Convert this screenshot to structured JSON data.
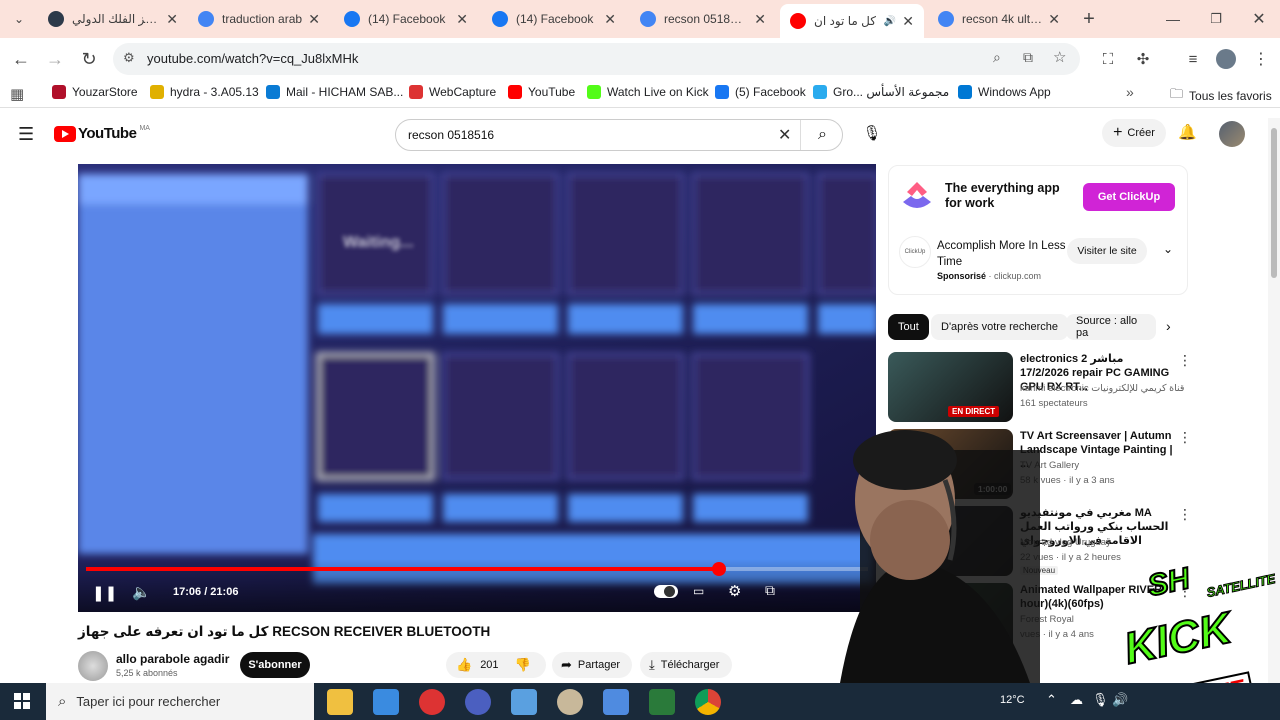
{
  "tabs": [
    {
      "title": "مركز الفلك الدولي",
      "icon": "globe-icon",
      "color": "#2d3a4a"
    },
    {
      "title": "traduction arab",
      "icon": "google-icon",
      "color": "#4285f4"
    },
    {
      "title": "(14) Facebook",
      "icon": "facebook-icon",
      "color": "#1877f2"
    },
    {
      "title": "(14) Facebook",
      "icon": "facebook-icon",
      "color": "#1877f2"
    },
    {
      "title": "recson 0518516",
      "icon": "google-icon",
      "color": "#4285f4"
    },
    {
      "title": "كل ما تود ان",
      "icon": "youtube-icon",
      "color": "#ff0000",
      "active": true
    },
    {
      "title": "recson 4k ultra h",
      "icon": "google-icon",
      "color": "#4285f4"
    }
  ],
  "toolbar": {
    "url": "youtube.com/watch?v=cq_Ju8lxMHk"
  },
  "bookmarks": [
    {
      "label": "YouzarStore",
      "color": "#b0102a"
    },
    {
      "label": "hydra - 3.A05.13",
      "color": "#e0b000"
    },
    {
      "label": "Mail - HICHAM SAB...",
      "color": "#0a7bd4"
    },
    {
      "label": "WebCapture",
      "color": "#d33"
    },
    {
      "label": "YouTube",
      "color": "#ff0000"
    },
    {
      "label": "Watch Live on Kick",
      "color": "#53fc18"
    },
    {
      "label": "(5) Facebook",
      "color": "#1877f2"
    },
    {
      "label": "Gro... مجموعة الأسأس",
      "color": "#2aabee"
    },
    {
      "label": "Windows App",
      "color": "#0078d4"
    }
  ],
  "bookmarks_all": "Tous les favoris",
  "youtube": {
    "logo": "YouTube",
    "country": "MA",
    "search_value": "recson 0518516",
    "create_label": "Créer"
  },
  "player": {
    "time": "17:06 / 21:06",
    "progress": 0.81,
    "overlay_text": "Waiting..."
  },
  "video": {
    "title": "كل ما تود ان تعرفه على جهاز RECSON RECEIVER BLUETOOTH",
    "channel": "allo parabole agadir",
    "subscribers": "5,25 k abonnés",
    "subscribe_label": "S'abonner",
    "likes": "201",
    "share_label": "Partager",
    "download_label": "Télécharger"
  },
  "ad": {
    "headline": "The everything app for work",
    "cta": "Get ClickUp",
    "brand": "ClickUp",
    "title": "Accomplish More In Less Time",
    "sponsored": "Sponsorisé",
    "domain": "clickup.com",
    "visit_label": "Visiter le site"
  },
  "chips": [
    "Tout",
    "D'après votre recherche",
    "Source : allo pa"
  ],
  "recommendations": [
    {
      "title": "electronics 2 مباشر 17/2/2026 repair PC GAMING GPU RX RT...",
      "channel": "karimi electronic قناة كريمي للإلكترونيات",
      "meta": "161 spectateurs",
      "badge": "EN DIRECT",
      "thumb": "#3a5a5a"
    },
    {
      "title": "TV Art Screensaver | Autumn Landscape Vintage Painting | ...",
      "channel": "TV Art Gallery",
      "meta": "58 k vues · il y a 3 ans",
      "badge": "1:00:00",
      "thumb": "#6b4a2e"
    },
    {
      "title": "مغربي في مونتفيديو MA الحساب بنكي ورواتب العمل الاقامة في الاوروجواي",
      "channel": "Mourad vlog Uruguay",
      "meta": "22 vues · il y a 2 heures",
      "badge": "Nouveau",
      "thumb": "#2a2a3a"
    },
    {
      "title": "Animated Wallpaper RIVER hour)(4k)(60fps)",
      "channel": "Forest Royal",
      "meta": "vues · il y a 4 ans",
      "badge": "",
      "thumb": "#2b5a3a"
    }
  ],
  "stream_badge": {
    "brand": "SH",
    "sub": "SATELLITE",
    "kick": "KICK",
    "live": "LIVE"
  },
  "taskbar": {
    "search_placeholder": "Taper ici pour rechercher",
    "temp": "12°C"
  }
}
